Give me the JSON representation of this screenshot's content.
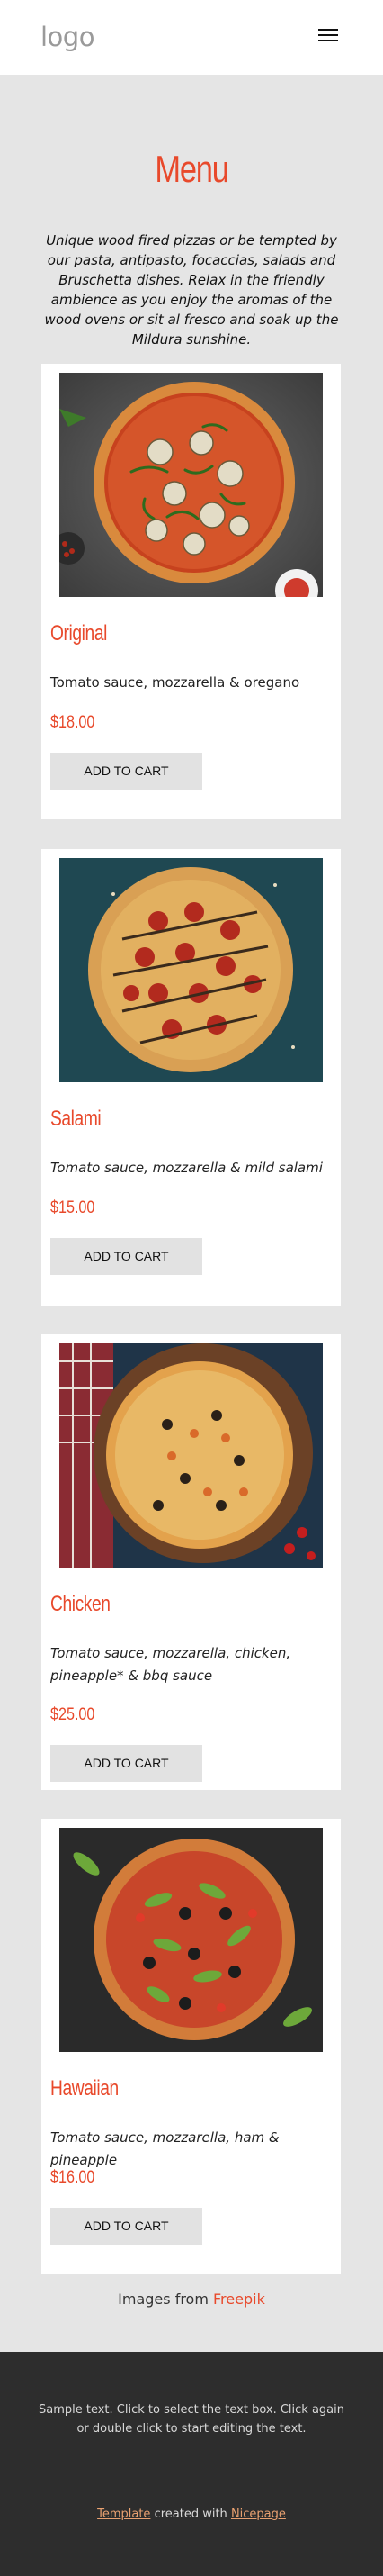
{
  "header": {
    "logo": "logo",
    "menu_icon": "hamburger-icon"
  },
  "hero": {
    "title": "Menu",
    "intro": "Unique wood fired pizzas or be tempted by our pasta, antipasto, focaccias, salads and Bruschetta dishes. Relax in the friendly ambience as you enjoy the aromas of the wood ovens or sit al fresco and soak up the Mildura sunshine."
  },
  "menu": {
    "items": [
      {
        "name": "Original",
        "description": "Tomato sauce, mozzarella & oregano",
        "price": "$18.00",
        "button": "ADD TO CART"
      },
      {
        "name": "Salami",
        "description": "Tomato sauce, mozzarella & mild salami",
        "price": "$15.00",
        "button": "ADD TO CART"
      },
      {
        "name": "Chicken",
        "description": "Tomato sauce, mozzarella, chicken, pineapple* & bbq sauce",
        "price": "$25.00",
        "button": "ADD TO CART"
      },
      {
        "name": "Hawaiian",
        "description": "Tomato sauce, mozzarella, ham & pineapple",
        "price": "$16.00",
        "button": "ADD TO CART"
      }
    ]
  },
  "credits": {
    "prefix": "Images from",
    "link": "Freepik"
  },
  "footer": {
    "text": "Sample text. Click to select the text box. Click again or double click to start editing the text.",
    "template_link": "Template",
    "created_with": "created with",
    "builder_link": "Nicepage"
  },
  "colors": {
    "accent": "#e8492b",
    "footer_bg": "#2d2d2d",
    "page_bg": "#e5e5e5"
  }
}
